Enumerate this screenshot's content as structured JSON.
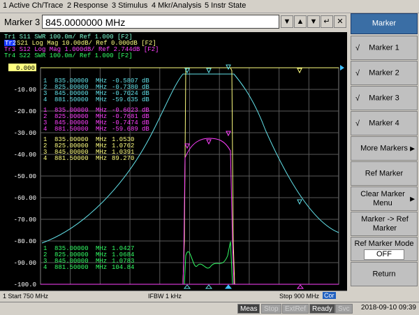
{
  "menu": [
    "1 Active Ch/Trace",
    "2 Response",
    "3 Stimulus",
    "4 Mkr/Analysis",
    "5 Instr State"
  ],
  "entry": {
    "label": "Marker 3",
    "value": "845.0000000 MHz"
  },
  "trace_legend": [
    {
      "text": "Tr1 S11 SWR 100.0m/ Ref 1.000 [F2]",
      "color": "#7fffd4"
    },
    {
      "text": "S21 Log Mag 10.00dB/ Ref 0.000dB [F2]",
      "tag": "Tr2",
      "color": "#ffff80"
    },
    {
      "text": "Tr3 S12 Log Mag 1.000dB/ Ref 2.744dB [F2]",
      "color": "#ff40ff"
    },
    {
      "text": "Tr4 S22 SWR 100.0m/ Ref 1.000 [F2]",
      "color": "#33ff66"
    }
  ],
  "y_axis": {
    "labels": [
      "0.000",
      "-10.00",
      "-20.00",
      "-30.00",
      "-40.00",
      "-50.00",
      "-60.00",
      "-70.00",
      "-80.00",
      "-90.00",
      "-100.0"
    ]
  },
  "marker_tables": [
    {
      "color": "#62e0e8",
      "rows": [
        [
          "1",
          "835.00000",
          "MHz",
          "-0.5807",
          "dB"
        ],
        [
          "2",
          "825.00000",
          "MHz",
          "-0.7380",
          "dB"
        ],
        [
          "3",
          "845.00000",
          "MHz",
          "-0.7024",
          "dB"
        ],
        [
          "4",
          "881.50000",
          "MHz",
          "-59.635",
          "dB"
        ]
      ]
    },
    {
      "color": "#ff40ff",
      "rows": [
        [
          "1",
          "835.00000",
          "MHz",
          "-0.6023",
          "dB"
        ],
        [
          "2",
          "825.00000",
          "MHz",
          "-0.7681",
          "dB"
        ],
        [
          "3",
          "845.00000",
          "MHz",
          "-0.7474",
          "dB"
        ],
        [
          "4",
          "881.50000",
          "MHz",
          "-59.689",
          "dB"
        ]
      ]
    },
    {
      "color": "#ffff80",
      "rows": [
        [
          "1",
          "835.00000",
          "MHz",
          "1.0530",
          ""
        ],
        [
          "2",
          "825.00000",
          "MHz",
          "1.0762",
          ""
        ],
        [
          "3",
          "845.00000",
          "MHz",
          "1.0391",
          ""
        ],
        [
          "4",
          "881.50000",
          "MHz",
          "89.270",
          ""
        ]
      ]
    },
    {
      "color": "#33ff66",
      "rows": [
        [
          "1",
          "835.00000",
          "MHz",
          "1.0427",
          ""
        ],
        [
          "2",
          "825.00000",
          "MHz",
          "1.0684",
          ""
        ],
        [
          "3",
          "845.00000",
          "MHz",
          "1.0783",
          ""
        ],
        [
          "4",
          "881.50000",
          "MHz",
          "104.84",
          ""
        ]
      ]
    }
  ],
  "softkeys": {
    "title": "Marker",
    "items": [
      {
        "label": "Marker 1",
        "checked": "√"
      },
      {
        "label": "Marker 2",
        "checked": "√"
      },
      {
        "label": "Marker 3",
        "checked": "√"
      },
      {
        "label": "Marker 4",
        "checked": "√"
      },
      {
        "label": "More Markers",
        "arrow": "▶"
      },
      {
        "label": "Ref Marker"
      },
      {
        "label": "Clear Marker Menu",
        "arrow": "▶"
      },
      {
        "label": "Marker -> Ref Marker"
      },
      {
        "label": "Ref Marker Mode",
        "value": "OFF"
      },
      {
        "label": "Return"
      }
    ]
  },
  "status": {
    "start": "1  Start 750 MHz",
    "ifbw": "IFBW 1 kHz",
    "stop": "Stop 900 MHz",
    "cor": "Cor"
  },
  "bottom": {
    "meas": "Meas",
    "stop": "Stop",
    "extref": "ExtRef",
    "ready": "Ready",
    "svc": "Svc",
    "clock": "2018-09-10 09:39"
  }
}
